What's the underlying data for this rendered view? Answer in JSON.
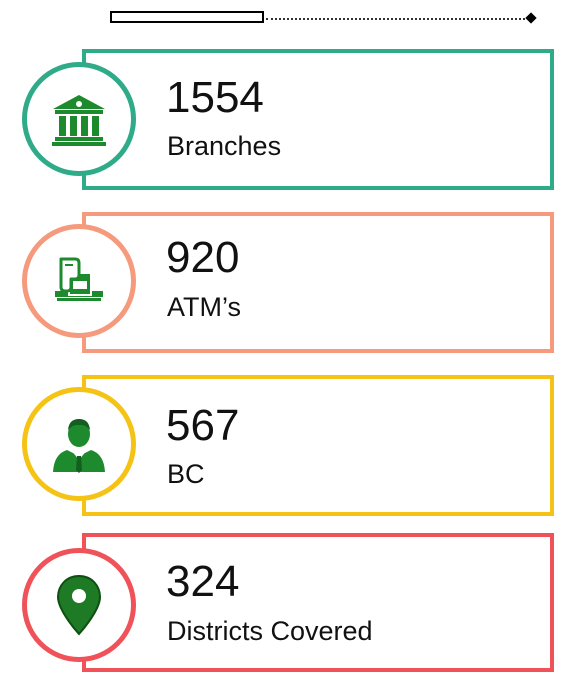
{
  "stats": [
    {
      "value": "1554",
      "label": "Branches",
      "icon": "bank-building-icon",
      "color": "#2fab8a"
    },
    {
      "value": "920",
      "label": "ATM’s",
      "icon": "atm-card-icon",
      "color": "#f59a7c"
    },
    {
      "value": "567",
      "label": "BC",
      "icon": "person-icon",
      "color": "#f5c316"
    },
    {
      "value": "324",
      "label": "Districts Covered",
      "icon": "location-pin-icon",
      "color": "#ef5258"
    }
  ],
  "icon_color": "#1e8a2e"
}
